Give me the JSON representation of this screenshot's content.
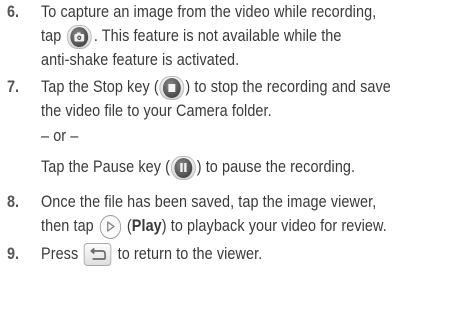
{
  "steps": [
    {
      "number": "6.",
      "lines": [
        "To capture an image from the video while recording,",
        {
          "before": "tap ",
          "icon": "camera-icon",
          "after": ". This feature is not available while the"
        },
        "anti-shake feature is activated."
      ]
    },
    {
      "number": "7.",
      "lines": [
        {
          "before": "Tap the Stop key (",
          "icon": "stop-icon",
          "after": ") to stop the recording and save"
        },
        "the video file to your Camera folder."
      ]
    },
    {
      "or_separator": "– or –",
      "lines": [
        {
          "before": "Tap the Pause key (",
          "icon": "pause-icon",
          "after": ") to pause the recording."
        }
      ]
    },
    {
      "number": "8.",
      "lines": [
        "Once the file has been saved, tap the image viewer,",
        {
          "before": "then tap ",
          "icon": "play-icon",
          "bold": "Play",
          "after": ") to playback your video for review."
        }
      ]
    },
    {
      "number": "9.",
      "lines": [
        {
          "before": "Press ",
          "icon": "back-icon",
          "after": " to return to the viewer."
        }
      ]
    }
  ],
  "text": {
    "s6_l1": "To capture an image from the video while recording,",
    "s6_l2_before": "tap ",
    "s6_l2_after": ". This feature is not available while the",
    "s6_l3": "anti-shake feature is activated.",
    "s7_l1_before": "Tap the Stop key (",
    "s7_l1_after": ") to stop the recording and save",
    "s7_l2": "the video file to your Camera folder.",
    "or_sep": "– or –",
    "pause_before": "Tap the Pause key (",
    "pause_after": ") to pause the recording.",
    "s8_l1": "Once the file has been saved, tap the image viewer,",
    "s8_l2_before": "then tap ",
    "s8_l2_paren_open": " (",
    "s8_l2_bold": "Play",
    "s8_l2_after": ") to playback your video for review.",
    "s9_before": "Press ",
    "s9_after": " to return to the viewer.",
    "n6": "6.",
    "n7": "7.",
    "n8": "8.",
    "n9": "9."
  },
  "colors": {
    "text": "#3a3a3a",
    "step_number": "#555555",
    "icon_dark": "#4a4a4a"
  }
}
